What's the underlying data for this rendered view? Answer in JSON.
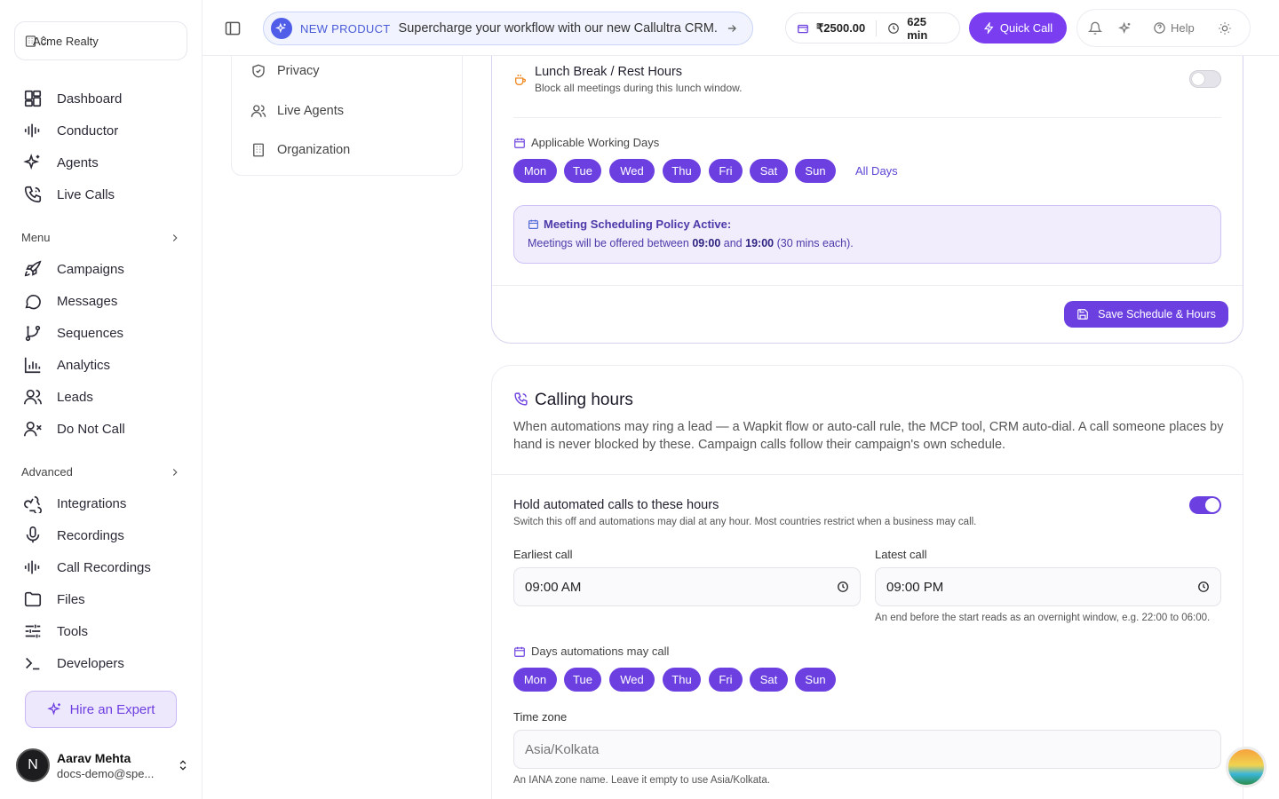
{
  "sidebar": {
    "org": "Acme Realty",
    "top_items": [
      {
        "label": "Dashboard",
        "icon": "dashboard-icon"
      },
      {
        "label": "Conductor",
        "icon": "waveform-icon"
      },
      {
        "label": "Agents",
        "icon": "sparkles-icon"
      },
      {
        "label": "Live Calls",
        "icon": "phone-icon"
      }
    ],
    "menu_title": "Menu",
    "menu_items": [
      {
        "label": "Campaigns",
        "icon": "rocket-icon"
      },
      {
        "label": "Messages",
        "icon": "message-icon"
      },
      {
        "label": "Sequences",
        "icon": "branch-icon"
      },
      {
        "label": "Analytics",
        "icon": "bar-chart-icon"
      },
      {
        "label": "Leads",
        "icon": "users-icon"
      },
      {
        "label": "Do Not Call",
        "icon": "user-x-icon"
      }
    ],
    "advanced_title": "Advanced",
    "advanced_items": [
      {
        "label": "Integrations",
        "icon": "webhook-icon"
      },
      {
        "label": "Recordings",
        "icon": "mic-icon"
      },
      {
        "label": "Call Recordings",
        "icon": "waveform-icon"
      },
      {
        "label": "Files",
        "icon": "folder-icon"
      },
      {
        "label": "Tools",
        "icon": "sliders-icon"
      },
      {
        "label": "Developers",
        "icon": "terminal-icon"
      }
    ],
    "hire": "Hire an Expert",
    "user": {
      "initial": "N",
      "name": "Aarav Mehta",
      "email": "docs-demo@spe..."
    }
  },
  "topbar": {
    "promo_tag": "NEW PRODUCT",
    "promo_text": "Supercharge your workflow with our new Callultra CRM.",
    "balance": "₹2500.00",
    "minutes": "625 min",
    "quick_call": "Quick Call",
    "help": "Help"
  },
  "settings_nav": [
    {
      "label": "Privacy",
      "icon": "shield-icon"
    },
    {
      "label": "Live Agents",
      "icon": "users-icon"
    },
    {
      "label": "Organization",
      "icon": "building-icon"
    }
  ],
  "schedule": {
    "lunch_title": "Lunch Break / Rest Hours",
    "lunch_desc": "Block all meetings during this lunch window.",
    "lunch_enabled": false,
    "days_label": "Applicable Working Days",
    "days": [
      "Mon",
      "Tue",
      "Wed",
      "Thu",
      "Fri",
      "Sat",
      "Sun"
    ],
    "all_days": "All Days",
    "policy_title": "Meeting Scheduling Policy Active:",
    "policy_prefix": "Meetings will be offered between",
    "policy_start": "09:00",
    "policy_and": "and",
    "policy_end": "19:00",
    "policy_suffix": "(30 mins each).",
    "save": "Save Schedule & Hours"
  },
  "calling": {
    "title": "Calling hours",
    "desc": "When automations may ring a lead — a Wapkit flow or auto-call rule, the MCP tool, CRM auto-dial. A call someone places by hand is never blocked by these. Campaign calls follow their campaign's own schedule.",
    "hold_title": "Hold automated calls to these hours",
    "hold_desc": "Switch this off and automations may dial at any hour. Most countries restrict when a business may call.",
    "hold_enabled": true,
    "earliest_label": "Earliest call",
    "earliest_value": "09:00 AM",
    "latest_label": "Latest call",
    "latest_value": "09:00 PM",
    "latest_hint": "An end before the start reads as an overnight window, e.g. 22:00 to 06:00.",
    "days_label": "Days automations may call",
    "days": [
      "Mon",
      "Tue",
      "Wed",
      "Thu",
      "Fri",
      "Sat",
      "Sun"
    ],
    "tz_label": "Time zone",
    "tz_placeholder": "Asia/Kolkata",
    "tz_hint": "An IANA zone name. Leave it empty to use Asia/Kolkata."
  },
  "colors": {
    "accent": "#6b3fe0",
    "promo": "#4f5de8"
  }
}
